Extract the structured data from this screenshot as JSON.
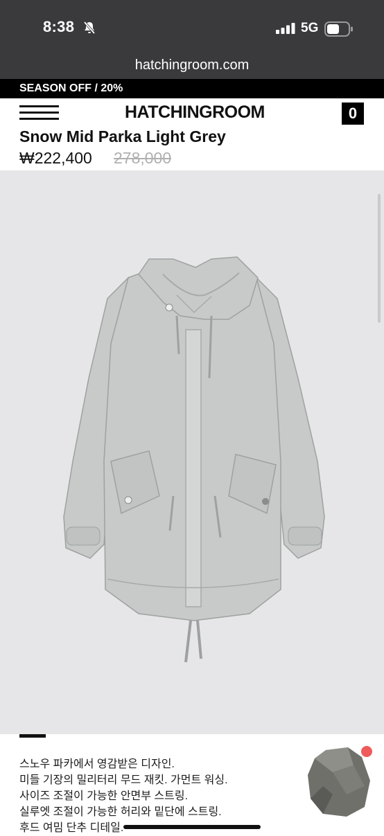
{
  "status": {
    "time": "8:38",
    "network": "5G",
    "icons": [
      "bell-slash-icon",
      "signal-bars-icon",
      "battery-icon"
    ]
  },
  "browser": {
    "url": "hatchingroom.com"
  },
  "promo": {
    "text": "SEASON OFF / 20%"
  },
  "header": {
    "logo": "HATCHINGROOM",
    "cart_count": "0",
    "menu_icon": "hamburger-menu-icon"
  },
  "product": {
    "title": "Snow Mid Parka Light Grey",
    "price": "₩222,400",
    "original_price": "278,000",
    "image_alt": "light grey hooded parka"
  },
  "description": {
    "lines": [
      "스노우 파카에서 영감받은 디자인.",
      "미들 기장의 밀리터리 무드 재킷. 가먼트 워싱.",
      "사이즈 조절이 가능한 안면부 스트링.",
      "실루엣 조절이 가능한 허리와 밑단에 스트링.",
      "후드 여밈 단추 디테일."
    ]
  },
  "colors": {
    "status_bg": "#3a3a3c",
    "promo_bg": "#000000",
    "image_bg": "#e6e6e8",
    "notification_dot": "#ef5a5a"
  }
}
